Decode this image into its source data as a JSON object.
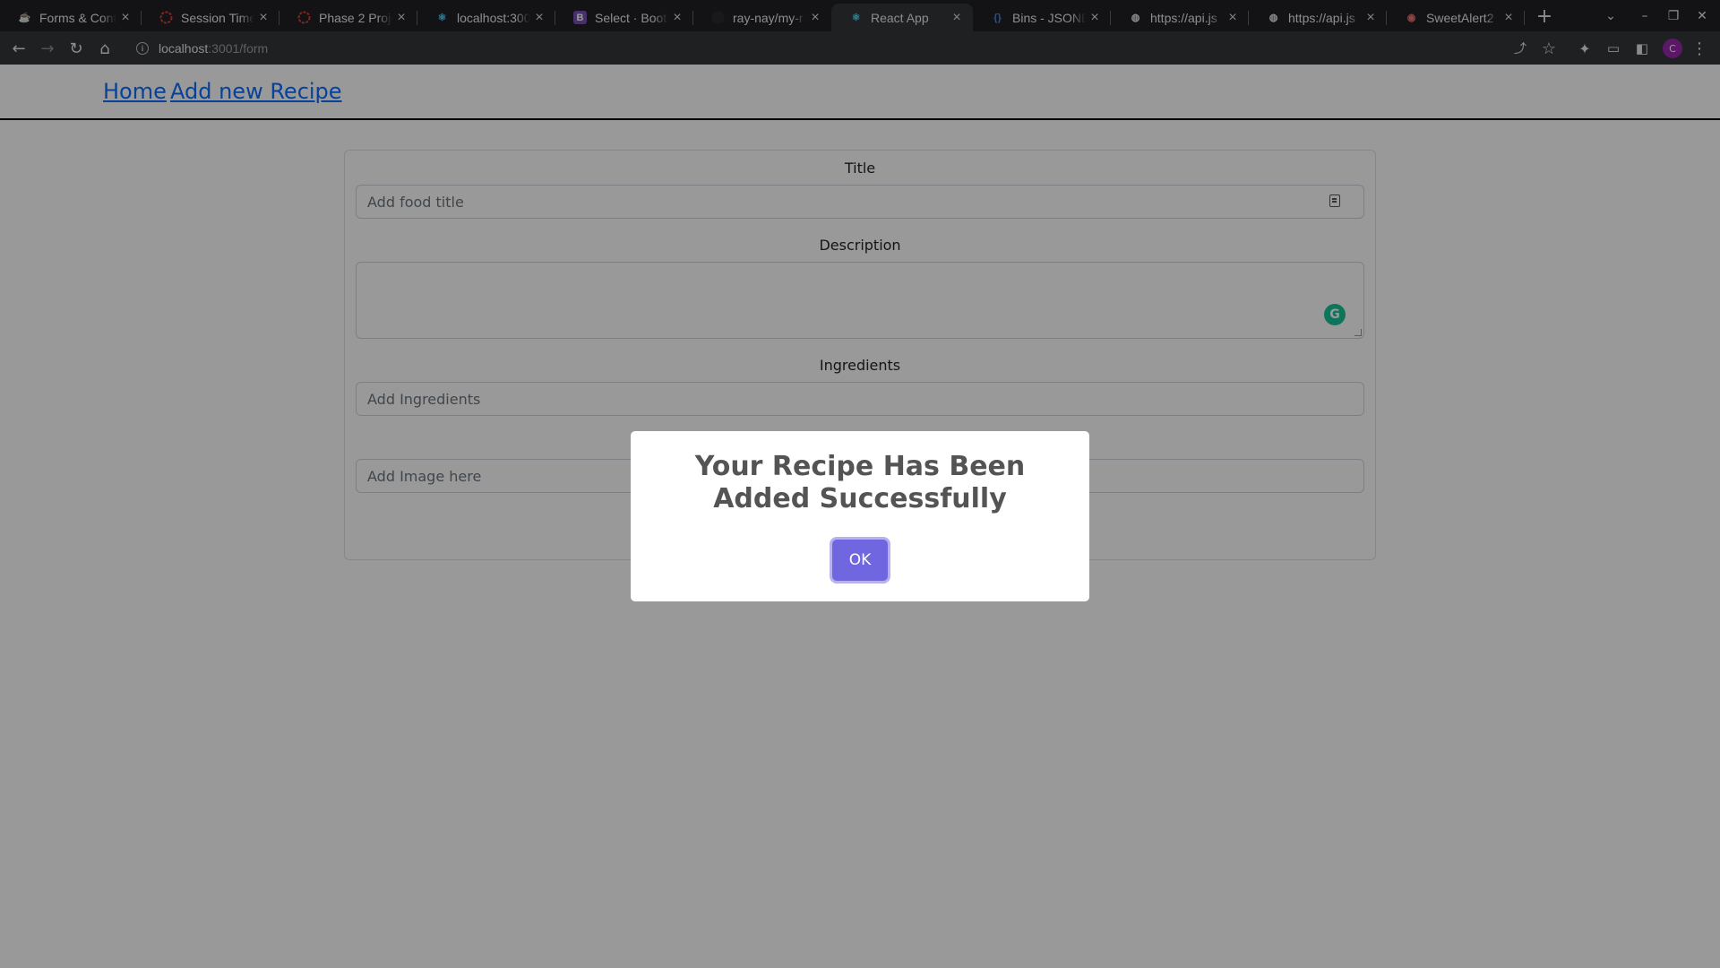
{
  "browser": {
    "tabs": [
      {
        "title": "Forms & Cont",
        "icon": "java-icon",
        "active": false
      },
      {
        "title": "Session Time",
        "icon": "ring-icon",
        "active": false
      },
      {
        "title": "Phase 2 Proje",
        "icon": "ring-icon",
        "active": false
      },
      {
        "title": "localhost:300",
        "icon": "react-icon",
        "active": false
      },
      {
        "title": "Select · Boots",
        "icon": "bootstrap-icon",
        "active": false
      },
      {
        "title": "ray-nay/my-r",
        "icon": "github-icon",
        "active": false
      },
      {
        "title": "React App",
        "icon": "react-icon",
        "active": true
      },
      {
        "title": "Bins - JSONB",
        "icon": "json-icon",
        "active": false
      },
      {
        "title": "https://api.js",
        "icon": "globe-icon",
        "active": false
      },
      {
        "title": "https://api.js",
        "icon": "globe-icon",
        "active": false
      },
      {
        "title": "SweetAlert2",
        "icon": "sweetalert-icon",
        "active": false
      }
    ],
    "address": {
      "host": "localhost",
      "rest": ":3001/form"
    },
    "profile_initial": "C"
  },
  "nav": {
    "home": "Home",
    "add": "Add new Recipe"
  },
  "form": {
    "title_label": "Title",
    "title_placeholder": "Add food title",
    "description_label": "Description",
    "ingredients_label": "Ingredients",
    "ingredients_placeholder": "Add Ingredients",
    "image_placeholder": "Add Image here"
  },
  "modal": {
    "title": "Your Recipe Has Been Added Successfully",
    "confirm": "OK"
  },
  "colors": {
    "confirm_button": "#7066e0",
    "link": "#0d6efd",
    "grammarly": "#15c39a"
  }
}
